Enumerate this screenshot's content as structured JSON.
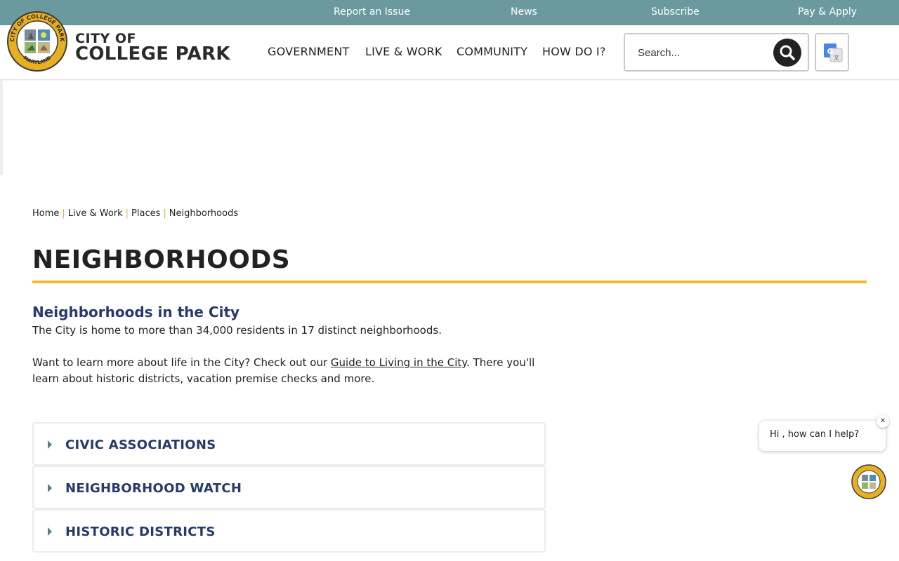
{
  "utility": {
    "links": [
      "Report an Issue",
      "News",
      "Subscribe",
      "Pay & Apply"
    ]
  },
  "brand": {
    "line1": "CITY OF",
    "line2": "COLLEGE PARK",
    "seal_top_text": "CITY OF COLLEGE PARK",
    "seal_bottom_text": "MARYLAND"
  },
  "nav": {
    "items": [
      "GOVERNMENT",
      "LIVE & WORK",
      "COMMUNITY",
      "HOW DO I?"
    ]
  },
  "search": {
    "placeholder": "Search..."
  },
  "breadcrumb": {
    "items": [
      "Home",
      "Live & Work",
      "Places",
      "Neighborhoods"
    ]
  },
  "page": {
    "title": "NEIGHBORHOODS",
    "section_heading": "Neighborhoods in the City",
    "para1": "The City is home to more than 34,000 residents in 17 distinct neighborhoods.",
    "para2_before": "Want to learn more about life in the City?  Check out our ",
    "para2_link": "Guide to Living in the City",
    "para2_after": ".  There you'll learn about historic districts, vacation premise checks and more."
  },
  "accordions": [
    "CIVIC ASSOCIATIONS",
    "NEIGHBORHOOD WATCH",
    "HISTORIC DISTRICTS"
  ],
  "chat": {
    "message": "Hi , how can I help?",
    "close_label": "✕"
  },
  "colors": {
    "utility_bar": "#6a9a9e",
    "accent_rule": "#f2bd2a",
    "heading_navy": "#263a6b"
  }
}
